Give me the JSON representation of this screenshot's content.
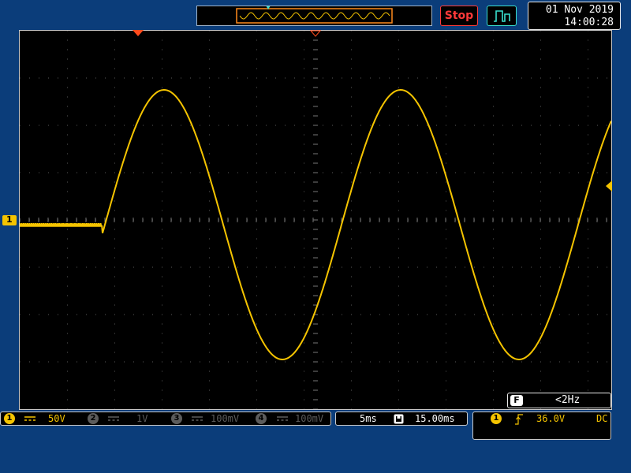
{
  "toolbar": {
    "run_state_label": "Stop",
    "acquire_mode_icon": "pulse-wave-icon"
  },
  "datetime": {
    "date": "01 Nov 2019",
    "time": "14:00:28"
  },
  "channels": [
    {
      "number": "1",
      "coupling": "dc-coupling-icon",
      "scale": "50V",
      "active": true,
      "color": "#f5c400"
    },
    {
      "number": "2",
      "coupling": "dc-coupling-icon",
      "scale": "1V",
      "active": false,
      "color": "#5c5c5c"
    },
    {
      "number": "3",
      "coupling": "dc-coupling-icon",
      "scale": "100mV",
      "active": false,
      "color": "#5c5c5c"
    },
    {
      "number": "4",
      "coupling": "dc-coupling-icon",
      "scale": "100mV",
      "active": false,
      "color": "#5c5c5c"
    }
  ],
  "timebase": {
    "scale": "5ms",
    "position": "15.00ms",
    "position_icon": "horizontal-position-icon"
  },
  "trigger": {
    "source": "1",
    "slope_icon": "rising-edge-icon",
    "level": "36.0V",
    "coupling": "DC"
  },
  "frequency_counter": {
    "badge": "F",
    "value": "<2Hz"
  },
  "ch1_marker_label": "1",
  "colors": {
    "background": "#0b3d7a",
    "trace_ch1": "#f5c400",
    "stop": "#ff3a3a",
    "acquire": "#39e0d0",
    "trigger_marker": "#ff4a1c",
    "grid": "#5a5a5a"
  },
  "waveform": {
    "baseline_level_div": -0.1,
    "step_time_div": -4.5,
    "sine_offset_div": -0.1,
    "sine_amplitude_div": 2.85,
    "sine_period_div": 5.0,
    "sine_peak_time_div": -3.2,
    "time_range_div": [
      -6.25,
      6.25
    ],
    "volt_range_div": [
      -4,
      4
    ]
  }
}
